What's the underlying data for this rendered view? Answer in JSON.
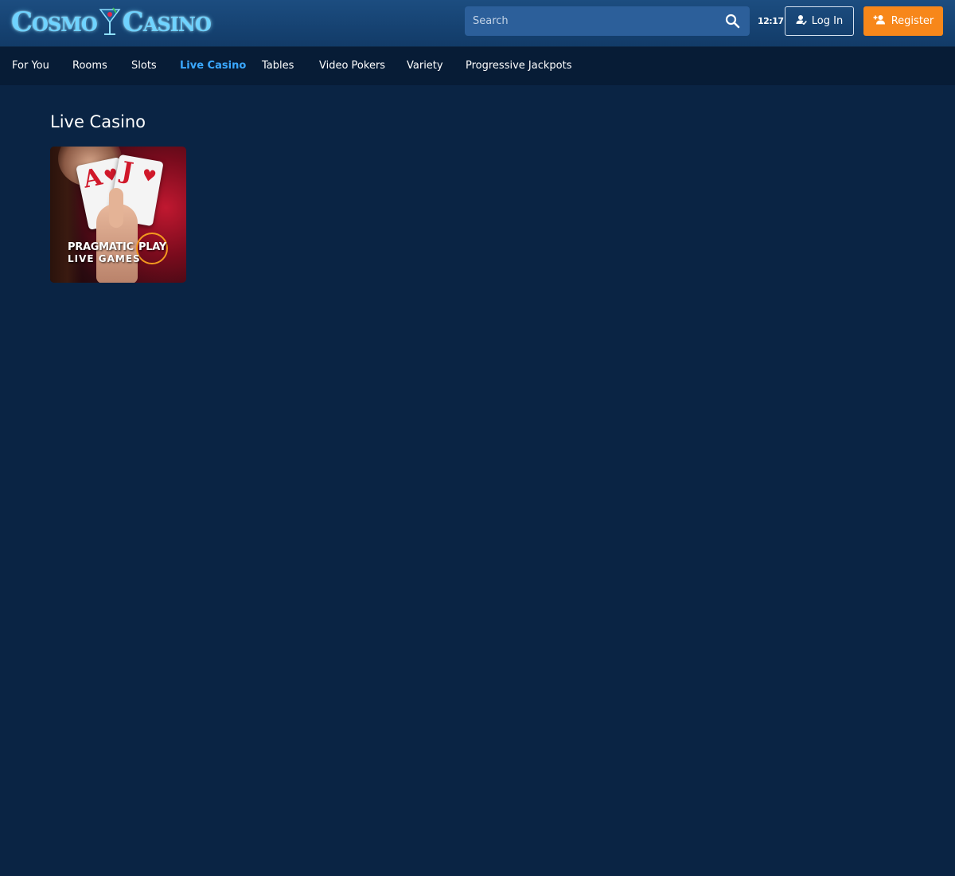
{
  "header": {
    "logo_text_left": "Cosmo",
    "logo_text_right": "Casino",
    "search": {
      "placeholder": "Search"
    },
    "clock": "12:17",
    "login_label": "Log In",
    "register_label": "Register"
  },
  "nav": {
    "items": [
      {
        "label": "For You"
      },
      {
        "label": "Rooms"
      },
      {
        "label": "Slots"
      },
      {
        "label": "Live Casino",
        "active": true
      },
      {
        "label": "Tables"
      },
      {
        "label": "Video Pokers"
      },
      {
        "label": "Variety"
      },
      {
        "label": "Progressive Jackpots"
      }
    ]
  },
  "main": {
    "section_title": "Live Casino",
    "games": [
      {
        "tile_text_line1": "PRAGMATIC",
        "tile_text_play": "PLAY",
        "tile_text_line2": "LIVE GAMES",
        "card1_letter": "A",
        "card2_letter": "J"
      }
    ]
  },
  "colors": {
    "page_bg": "#0a2444",
    "header_bg": "#1c4d80",
    "nav_bg": "#071c36",
    "accent_active": "#3aa8ff",
    "register_orange": "#f7871a",
    "search_bg": "#2c5f9a"
  },
  "icons": {
    "search": "search-icon",
    "login": "user-icon",
    "register": "add-user-icon"
  }
}
